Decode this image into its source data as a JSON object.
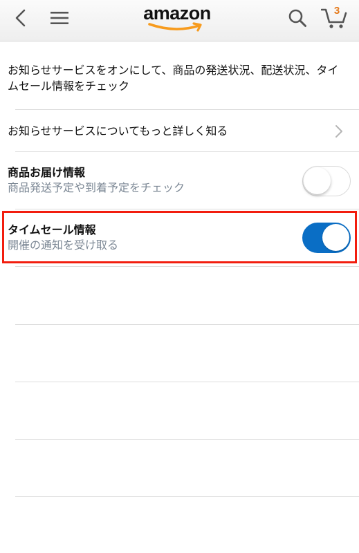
{
  "header": {
    "logo_text": "amazon",
    "cart_count": "3",
    "icons": {
      "back": "chevron-left-icon",
      "menu": "hamburger-menu-icon",
      "search": "search-icon",
      "cart": "cart-icon"
    }
  },
  "intro_text": "お知らせサービスをオンにして、商品の発送状況、配送状況、タイムセール情報をチェック",
  "learn_more": {
    "label": "お知らせサービスについてもっと詳しく知る"
  },
  "settings": [
    {
      "title": "商品お届け情報",
      "subtitle": "商品発送予定や到着予定をチェック",
      "enabled": false
    },
    {
      "title": "タイムセール情報",
      "subtitle": "開催の通知を受け取る",
      "enabled": true
    }
  ],
  "colors": {
    "toggle_on": "#0a6ec5",
    "highlight": "#f21d0e",
    "subtitle": "#7b8794",
    "logo_smile": "#f79b1d",
    "cart_badge": "#e4791a"
  }
}
